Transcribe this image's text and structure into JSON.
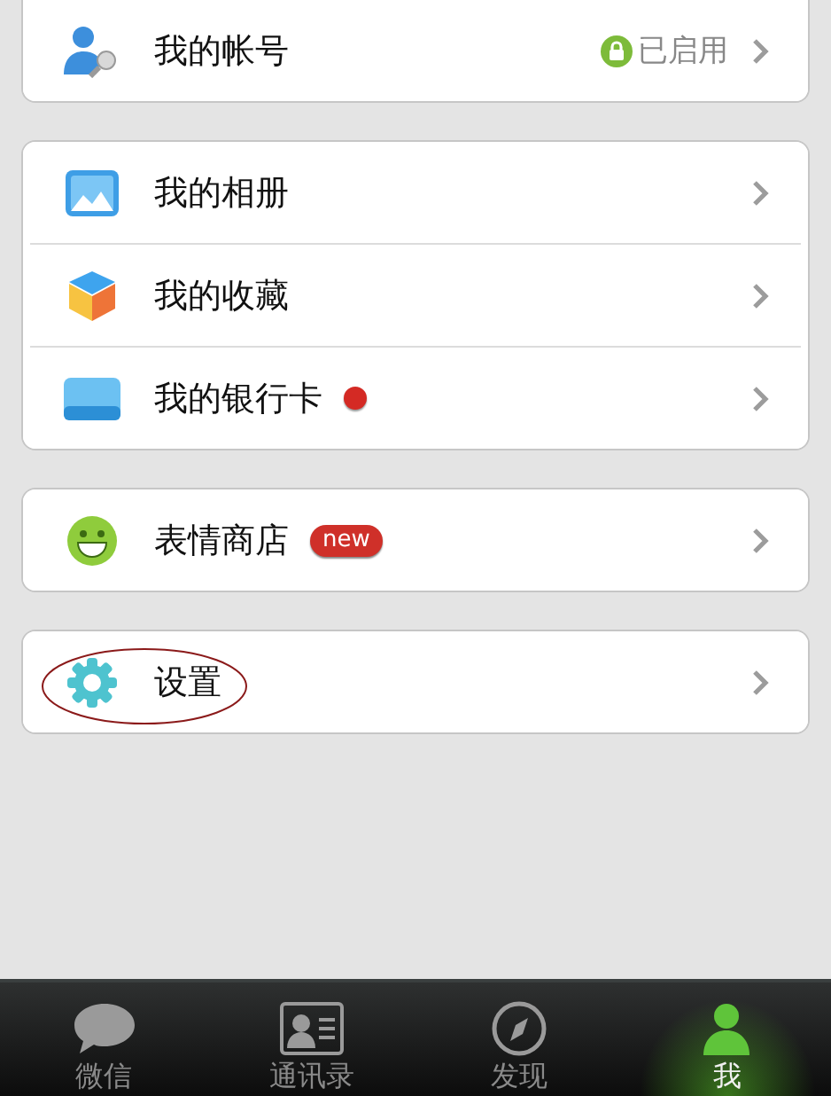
{
  "groups": [
    {
      "items": [
        {
          "kind": "account",
          "label": "我的帐号",
          "status": "已启用"
        }
      ]
    },
    {
      "items": [
        {
          "kind": "album",
          "label": "我的相册"
        },
        {
          "kind": "favorites",
          "label": "我的收藏"
        },
        {
          "kind": "card",
          "label": "我的银行卡",
          "dot": true
        }
      ]
    },
    {
      "items": [
        {
          "kind": "sticker",
          "label": "表情商店",
          "badge": "new"
        }
      ]
    },
    {
      "items": [
        {
          "kind": "settings",
          "label": "设置",
          "highlighted": true
        }
      ]
    }
  ],
  "tab_bar": [
    {
      "kind": "chats",
      "label": "微信",
      "selected": false
    },
    {
      "kind": "contacts",
      "label": "通讯录",
      "selected": false
    },
    {
      "kind": "discover",
      "label": "发现",
      "selected": false
    },
    {
      "kind": "me",
      "label": "我",
      "selected": true
    }
  ]
}
